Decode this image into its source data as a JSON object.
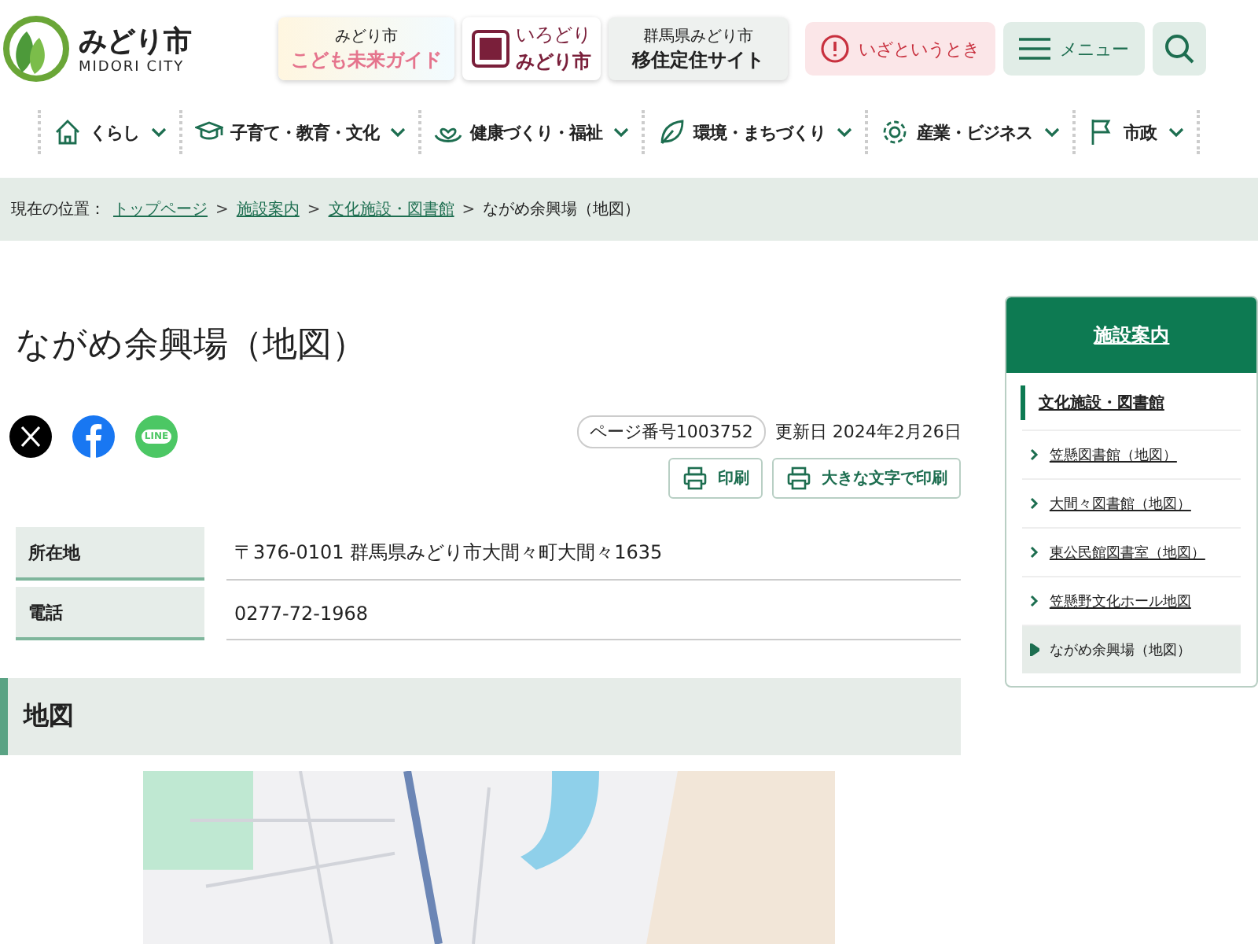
{
  "logo": {
    "name": "みどり市",
    "subtitle": "MIDORI CITY"
  },
  "banners": [
    {
      "kind": "kids",
      "lines": [
        "みどり市",
        "こども未来ガイド"
      ]
    },
    {
      "kind": "iro",
      "lines": [
        "いろどり",
        "みどり市"
      ]
    },
    {
      "kind": "iju",
      "lines": [
        "群馬県みどり市",
        "移住定住サイト"
      ]
    }
  ],
  "emergency_button": "いざというとき",
  "menu_button": "メニュー",
  "nav": [
    {
      "kind": "home",
      "label": "くらし"
    },
    {
      "kind": "cap",
      "label": "子育て・教育・文化"
    },
    {
      "kind": "heart",
      "label": "健康づくり・福祉"
    },
    {
      "kind": "leaf",
      "label": "環境・まちづくり"
    },
    {
      "kind": "gear",
      "label": "産業・ビジネス"
    },
    {
      "kind": "flag",
      "label": "市政"
    }
  ],
  "breadcrumb": {
    "label": "現在の位置：",
    "separator": ">",
    "links": [
      "トップページ",
      "施設案内",
      "文化施設・図書館"
    ],
    "current": "ながめ余興場（地図）"
  },
  "page_title": "ながめ余興場（地図）",
  "share": [
    {
      "kind": "x"
    },
    {
      "kind": "facebook"
    },
    {
      "kind": "line",
      "label": "LINE"
    }
  ],
  "page_number": "ページ番号1003752",
  "updated": "更新日 2024年2月26日",
  "print_buttons": [
    "印刷",
    "大きな文字で印刷"
  ],
  "info": [
    {
      "label": "所在地",
      "value": "〒376-0101 群馬県みどり市大間々町大間々1635"
    },
    {
      "label": "電話",
      "value": "0277-72-1968"
    }
  ],
  "map_heading": "地図",
  "sidebar": {
    "title": "施設案内",
    "parent": "文化施設・図書館",
    "items": [
      {
        "label": "笠懸図書館（地図）",
        "selected": false
      },
      {
        "label": "大間々図書館（地図）",
        "selected": false
      },
      {
        "label": "東公民館図書室（地図）",
        "selected": false
      },
      {
        "label": "笠懸野文化ホール地図",
        "selected": false
      },
      {
        "label": "ながめ余興場（地図）",
        "selected": true
      }
    ]
  }
}
